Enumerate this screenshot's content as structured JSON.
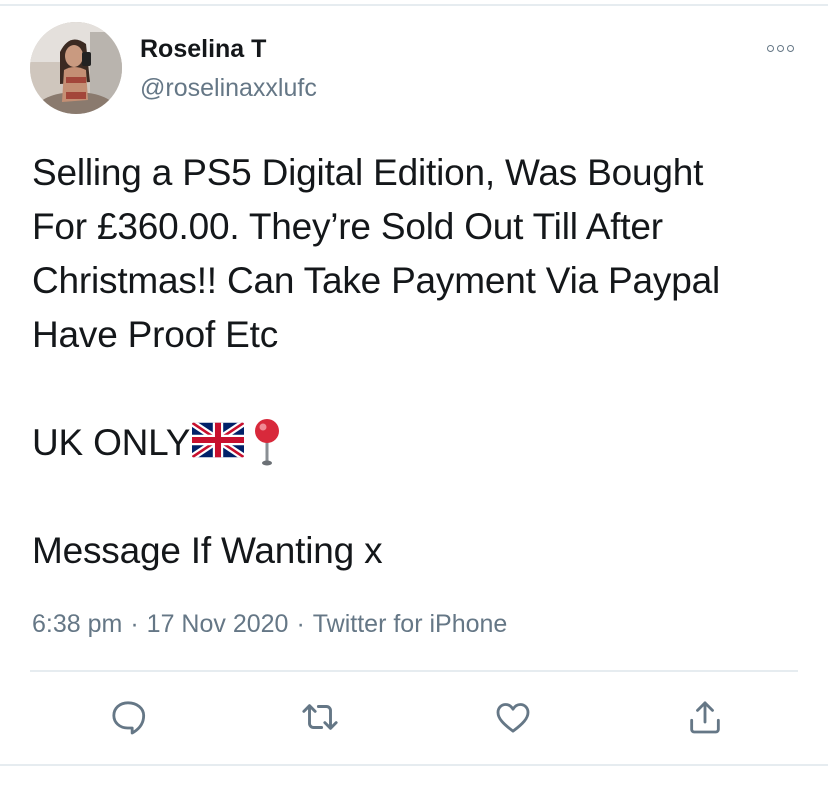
{
  "tweet": {
    "author": {
      "display_name": "Roselina T",
      "handle": "@roselinaxxlufc",
      "avatar_icon": "profile-photo"
    },
    "more_icon": "more-options-icon",
    "text_lines": [
      "Selling a PS5 Digital Edition, Was Bought",
      "For £360.00. They’re Sold Out Till After",
      "Christmas!! Can Take Payment Via Paypal",
      "Have Proof Etc"
    ],
    "uk_line": {
      "text": "UK ONLY",
      "emojis": [
        "uk-flag-emoji",
        "round-pushpin-emoji"
      ]
    },
    "closing_line": "Message If Wanting x",
    "meta": {
      "time": "6:38 pm",
      "separator": "·",
      "date": "17 Nov 2020",
      "source": "Twitter for iPhone"
    },
    "actions": [
      {
        "name": "reply",
        "icon": "reply-icon"
      },
      {
        "name": "retweet",
        "icon": "retweet-icon"
      },
      {
        "name": "like",
        "icon": "heart-icon"
      },
      {
        "name": "share",
        "icon": "share-icon"
      }
    ],
    "colors": {
      "text": "#14171a",
      "secondary": "#657786",
      "divider": "#e6ecf0",
      "flag_blue": "#012169",
      "flag_red": "#C8102E",
      "pin_red": "#d8293b"
    }
  }
}
